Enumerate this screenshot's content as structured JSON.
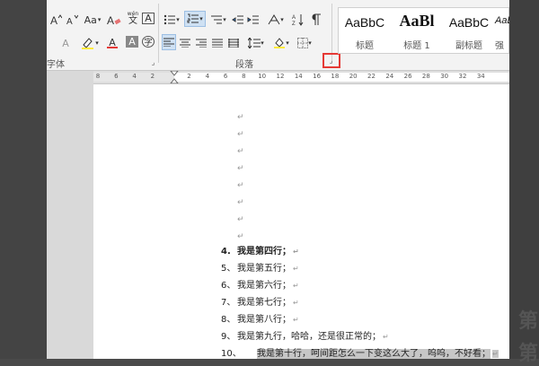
{
  "ribbon": {
    "font_group_label": "字体",
    "paragraph_group_label": "段落",
    "case_button": "Aa",
    "font_color_letter": "A",
    "highlight_letter": "A",
    "phonetic_char": "wén",
    "phonetic_glyph": "文",
    "enclose_char": "A",
    "shade_char": "A",
    "circle_char": "字",
    "sort_label": "A↓",
    "char_spacing_label": "AZ"
  },
  "styles": [
    {
      "sample": "AaBbC",
      "name": "标题"
    },
    {
      "sample": "AaBl",
      "name": "标题 1"
    },
    {
      "sample": "AaBbC",
      "name": "副标题"
    },
    {
      "sample": "AaBbC",
      "name": "强"
    }
  ],
  "ruler": {
    "ticks": [
      "8",
      "6",
      "4",
      "2",
      "",
      "2",
      "4",
      "6",
      "8",
      "10",
      "12",
      "14",
      "16",
      "18",
      "20",
      "22",
      "24",
      "26",
      "28",
      "30",
      "32",
      "34"
    ]
  },
  "document": {
    "paragraph_mark": "↵",
    "lines": [
      {
        "num": "4.",
        "text": "我是第四行；",
        "bold": true,
        "highlight": false
      },
      {
        "num": "5、",
        "text": "我是第五行；",
        "bold": false,
        "highlight": false
      },
      {
        "num": "6、",
        "text": "我是第六行；",
        "bold": false,
        "highlight": false
      },
      {
        "num": "7、",
        "text": "我是第七行；",
        "bold": false,
        "highlight": false
      },
      {
        "num": "8、",
        "text": "我是第八行；",
        "bold": false,
        "highlight": false
      },
      {
        "num": "9、",
        "text": "我是第九行，哈哈，还是很正常的；",
        "bold": false,
        "highlight": false
      },
      {
        "num": "10、",
        "text": "我是第十行，呵间距怎么一下变这么大了，呜呜，不好看；",
        "bold": false,
        "highlight": true
      }
    ]
  },
  "background": {
    "right_ghost_1": "第",
    "right_ghost_2": "第"
  }
}
